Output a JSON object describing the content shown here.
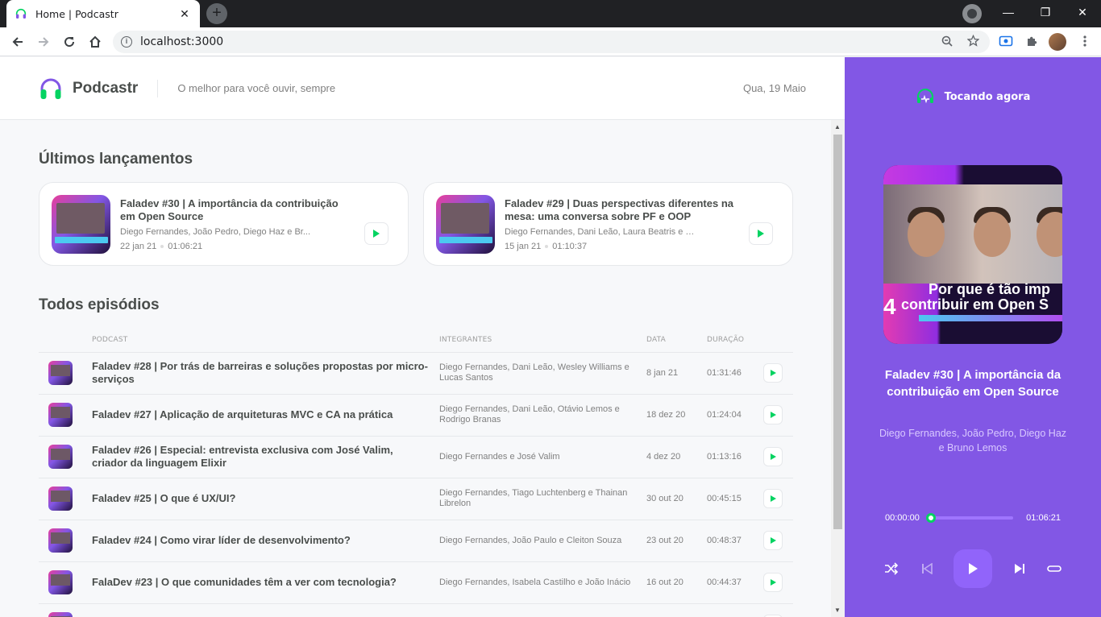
{
  "browser": {
    "tab_title": "Home | Podcastr",
    "url": "localhost:3000",
    "win_minimize": "—",
    "win_restore": "❐",
    "win_close": "✕",
    "tab_close": "✕",
    "new_tab": "+"
  },
  "header": {
    "app_name": "Podcastr",
    "tagline": "O melhor para você ouvir, sempre",
    "date": "Qua, 19 Maio"
  },
  "latest": {
    "title": "Últimos lançamentos",
    "items": [
      {
        "title": "Faladev #30 | A importância da contribuição em Open Source",
        "members": "Diego Fernandes, João Pedro, Diego Haz e Br...",
        "date": "22 jan 21",
        "duration": "01:06:21"
      },
      {
        "title": "Faladev #29 | Duas perspectivas diferentes na mesa: uma conversa sobre PF e OOP",
        "members": "Diego Fernandes, Dani Leão, Laura Beatris e R...",
        "date": "15 jan 21",
        "duration": "01:10:37"
      }
    ]
  },
  "all": {
    "title": "Todos episódios",
    "columns": [
      "Podcast",
      "Integrantes",
      "Data",
      "Duração"
    ],
    "rows": [
      {
        "title": "Faladev #28 | Por trás de barreiras e soluções propostas por micro-serviços",
        "members": "Diego Fernandes, Dani Leão, Wesley Williams e Lucas Santos",
        "date": "8 jan 21",
        "duration": "01:31:46"
      },
      {
        "title": "Faladev #27 | Aplicação de arquiteturas MVC e CA na prática",
        "members": "Diego Fernandes, Dani Leão, Otávio Lemos e Rodrigo Branas",
        "date": "18 dez 20",
        "duration": "01:24:04"
      },
      {
        "title": "Faladev #26 | Especial: entrevista exclusiva com José Valim, criador da linguagem Elixir",
        "members": "Diego Fernandes e José Valim",
        "date": "4 dez 20",
        "duration": "01:13:16"
      },
      {
        "title": "Faladev #25 | O que é UX/UI?",
        "members": "Diego Fernandes, Tiago Luchtenberg e Thainan Librelon",
        "date": "30 out 20",
        "duration": "00:45:15"
      },
      {
        "title": "Faladev #24 | Como virar líder de desenvolvimento?",
        "members": "Diego Fernandes, João Paulo e Cleiton Souza",
        "date": "23 out 20",
        "duration": "00:48:37"
      },
      {
        "title": "FalaDev #23 | O que comunidades têm a ver com tecnologia?",
        "members": "Diego Fernandes, Isabela Castilho e João Inácio",
        "date": "16 out 20",
        "duration": "00:44:37"
      }
    ]
  },
  "player": {
    "heading": "Tocando agora",
    "cover_line1": "Por que é tão imp",
    "cover_line2": "contribuir em Open S",
    "cover_number": "4",
    "title": "Faladev #30 | A importância da contribuição em Open Source",
    "members": "Diego Fernandes, João Pedro, Diego Haz e Bruno Lemos",
    "current_time": "00:00:00",
    "total_time": "01:06:21",
    "progress": 0
  },
  "colors": {
    "purple": "#8257e5",
    "green": "#04d361",
    "text": "#494d4b",
    "muted": "#808080"
  }
}
